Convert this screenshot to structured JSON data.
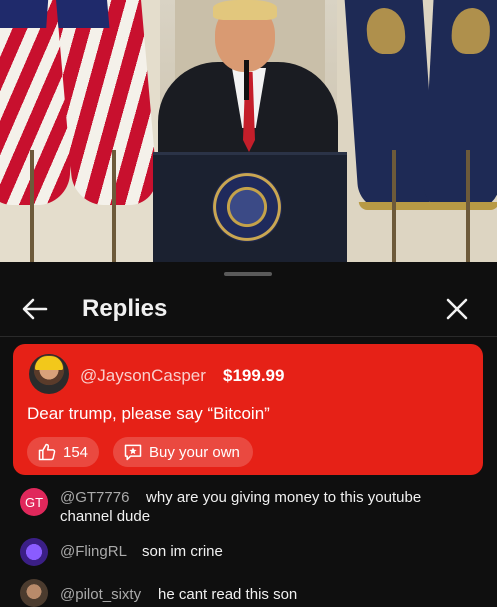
{
  "sheet": {
    "title": "Replies"
  },
  "super_chat": {
    "author": "@JaysonCasper",
    "amount": "$199.99",
    "message": "Dear trump, please say “Bitcoin”",
    "like_count": "154",
    "buy_label": "Buy your own",
    "background_color": "#e62117"
  },
  "replies": [
    {
      "avatar_initials": "GT",
      "author": "@GT7776",
      "message_line1": "why are you giving money to this youtube",
      "message_line2": "channel dude"
    },
    {
      "author": "@FlingRL",
      "message_line1": "son im crine"
    },
    {
      "author": "@pilot_sixty",
      "message_line1": "he cant read this son"
    }
  ],
  "icons": {
    "back": "arrow-left-icon",
    "close": "close-icon",
    "like": "thumbs-up-icon",
    "buy": "super-chat-icon"
  }
}
